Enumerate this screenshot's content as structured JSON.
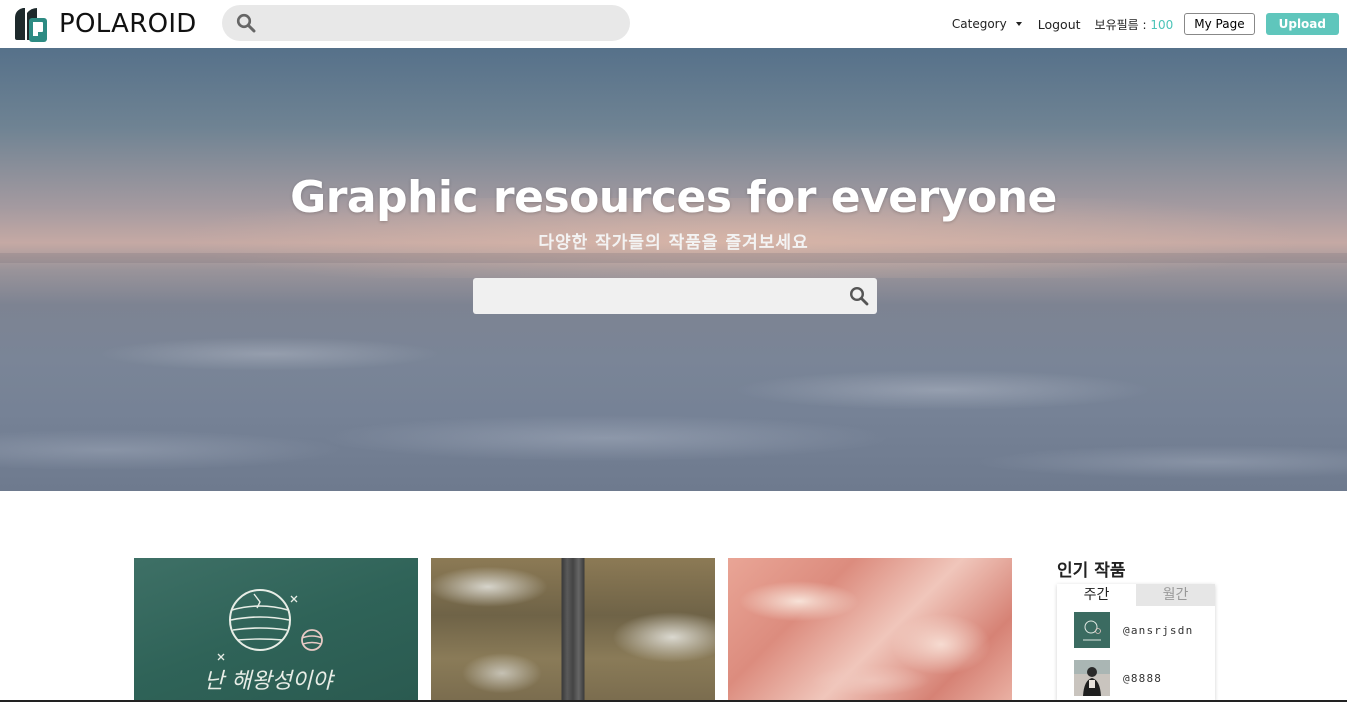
{
  "brand": {
    "name": "POLAROID"
  },
  "topbar": {
    "search_placeholder": "",
    "category_label": "Category",
    "logout_label": "Logout",
    "film_label": "보유필름 : ",
    "film_count": "100",
    "mypage_label": "My Page",
    "upload_label": "Upload"
  },
  "hero": {
    "title": "Graphic resources for everyone",
    "subtitle": "다양한 작가들의 작품을 즐겨보세요",
    "search_placeholder": ""
  },
  "gallery": {
    "cards": [
      {
        "chalk_text": "난 해왕성이야"
      },
      {},
      {}
    ]
  },
  "popular": {
    "title": "인기 작품",
    "tabs": [
      {
        "label": "주간",
        "active": true
      },
      {
        "label": "월간",
        "active": false
      }
    ],
    "items": [
      {
        "user": "@ansrjsdn"
      },
      {
        "user": "@8888"
      }
    ]
  },
  "colors": {
    "accent": "#5fc6bc",
    "film_count": "#4bc4b8"
  }
}
